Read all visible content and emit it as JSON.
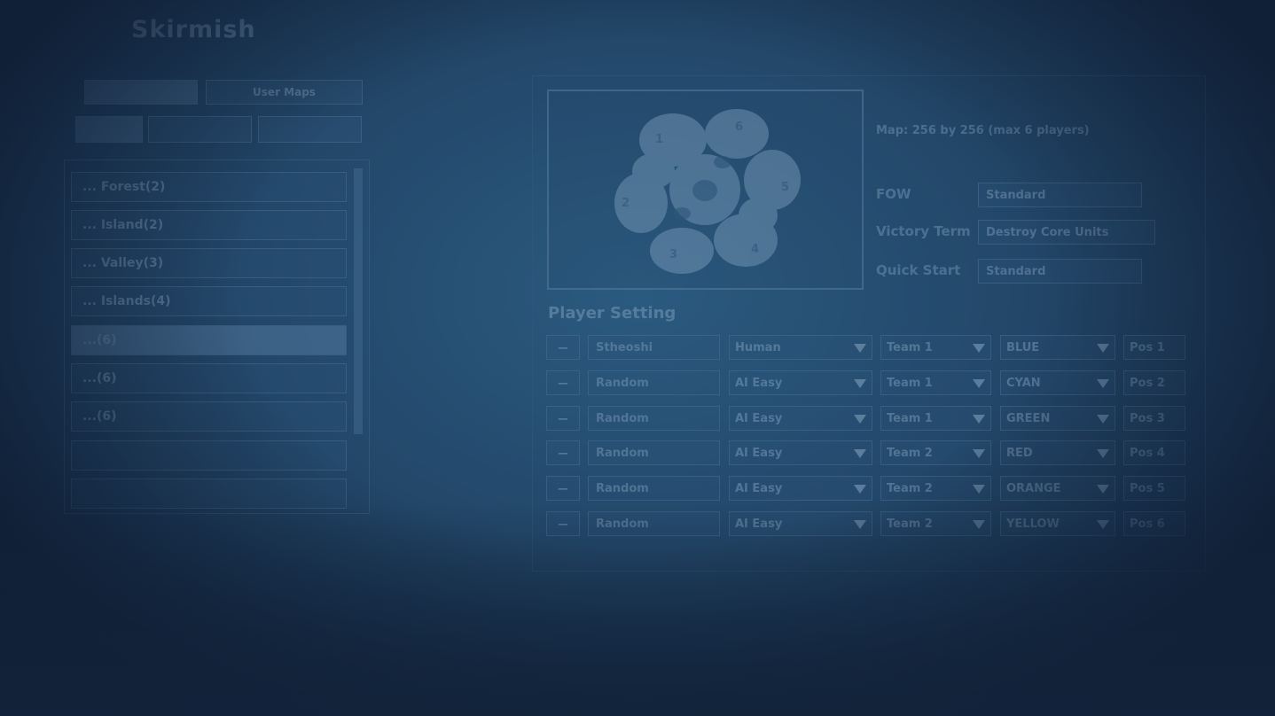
{
  "title": "Skirmish",
  "tabs": {
    "row1": [
      "",
      "User Maps"
    ],
    "row2": [
      "",
      "",
      ""
    ]
  },
  "maps": [
    {
      "label": "... Forest(2)"
    },
    {
      "label": "... Island(2)"
    },
    {
      "label": "... Valley(3)"
    },
    {
      "label": "... Islands(4)"
    },
    {
      "label": "...(6)",
      "selected": true
    },
    {
      "label": "...(6)"
    },
    {
      "label": "...(6)"
    },
    {
      "label": ""
    },
    {
      "label": ""
    }
  ],
  "map_preview": {
    "spawn_numbers": [
      "1",
      "2",
      "3",
      "4",
      "5",
      "6"
    ]
  },
  "map_info": {
    "line1": "",
    "line2": "Map: 256 by 256 (max 6 players)"
  },
  "settings": [
    {
      "label": "FOW",
      "value": "Standard"
    },
    {
      "label": "Victory Term",
      "value": "Destroy Core Units"
    },
    {
      "label": "Quick Start",
      "value": "Standard"
    }
  ],
  "player_section_title": "Player Setting",
  "players": [
    {
      "minus": "−",
      "name": "Stheoshi",
      "type": "Human",
      "team": "Team 1",
      "color": "BLUE",
      "pos": "Pos 1"
    },
    {
      "minus": "−",
      "name": "Random",
      "type": "AI Easy",
      "team": "Team 1",
      "color": "CYAN",
      "pos": "Pos 2"
    },
    {
      "minus": "−",
      "name": "Random",
      "type": "AI Easy",
      "team": "Team 1",
      "color": "GREEN",
      "pos": "Pos 3"
    },
    {
      "minus": "−",
      "name": "Random",
      "type": "AI Easy",
      "team": "Team 2",
      "color": "RED",
      "pos": "Pos 4"
    },
    {
      "minus": "−",
      "name": "Random",
      "type": "AI Easy",
      "team": "Team 2",
      "color": "ORANGE",
      "pos": "Pos 5"
    },
    {
      "minus": "−",
      "name": "Random",
      "type": "AI Easy",
      "team": "Team 2",
      "color": "YELLOW",
      "pos": "Pos 6"
    }
  ]
}
